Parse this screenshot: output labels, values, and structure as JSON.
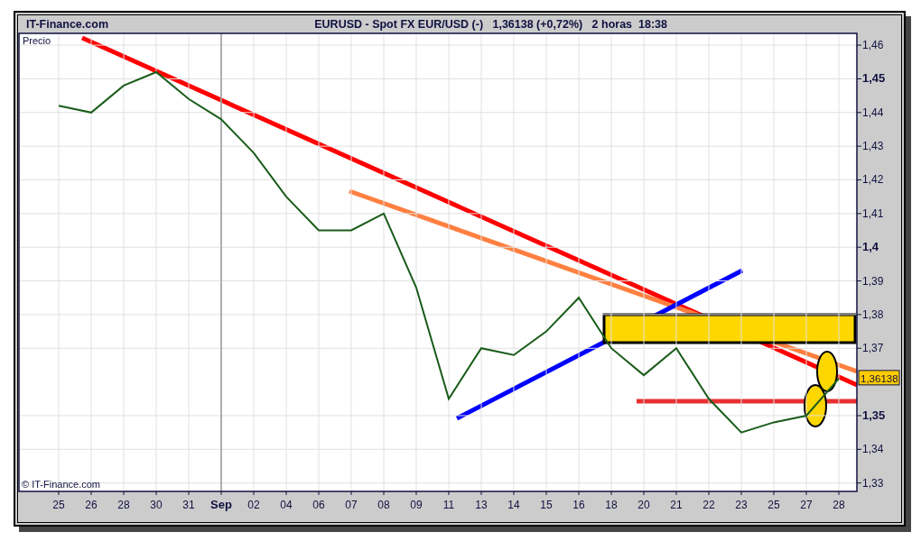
{
  "header": {
    "brand": "IT-Finance.com",
    "title": "EURUSD - Spot FX EUR/USD (-)   1,36138 (+0,72%)   2 horas  18:38"
  },
  "chart": {
    "axis_caption": "Precio",
    "copyright": "© IT-Finance.com",
    "price_tag": {
      "text": "1,36138",
      "color": "#ffcc00"
    },
    "overlays": [
      {
        "kind": "line",
        "color": "#ff0000"
      },
      {
        "kind": "line",
        "color": "#ff8040"
      },
      {
        "kind": "line",
        "color": "#0000ff"
      },
      {
        "kind": "line",
        "color": "#e83030"
      },
      {
        "kind": "rect",
        "color": "#ffd700"
      },
      {
        "kind": "ellipse",
        "color": "#ffd700"
      },
      {
        "kind": "ellipse",
        "color": "#ffd700"
      }
    ],
    "chart_data": {
      "type": "line",
      "grid": true,
      "ref_lines": [
        {
          "axis": "x",
          "value": "Sep",
          "color": "#999999"
        }
      ],
      "categories": [
        "25",
        "26",
        "28",
        "30",
        "31",
        "Sep",
        "02",
        "04",
        "06",
        "07",
        "08",
        "09",
        "11",
        "13",
        "14",
        "15",
        "16",
        "18",
        "20",
        "21",
        "22",
        "23",
        "25",
        "27",
        "28"
      ],
      "series": [
        {
          "color": "#1a5c1a",
          "values": [
            1.442,
            1.44,
            1.448,
            1.452,
            1.444,
            1.438,
            1.428,
            1.415,
            1.405,
            1.405,
            1.41,
            1.388,
            1.355,
            1.37,
            1.368,
            1.375,
            1.385,
            1.37,
            1.362,
            1.37,
            1.355,
            1.345,
            1.348,
            1.35,
            1.361
          ]
        }
      ],
      "ylim": [
        1.3275,
        1.4635
      ],
      "yticks": [
        {
          "value": 1.46,
          "label": "1,46"
        },
        {
          "value": 1.45,
          "label": "1,45"
        },
        {
          "value": 1.44,
          "label": "1,44"
        },
        {
          "value": 1.43,
          "label": "1,43"
        },
        {
          "value": 1.42,
          "label": "1,42"
        },
        {
          "value": 1.41,
          "label": "1,41"
        },
        {
          "value": 1.4,
          "label": "1,4"
        },
        {
          "value": 1.39,
          "label": "1,39"
        },
        {
          "value": 1.38,
          "label": "1,38"
        },
        {
          "value": 1.37,
          "label": "1,37"
        },
        {
          "value": 1.35,
          "label": "1,35"
        },
        {
          "value": 1.34,
          "label": "1,34"
        },
        {
          "value": 1.33,
          "label": "1,33"
        }
      ]
    }
  }
}
